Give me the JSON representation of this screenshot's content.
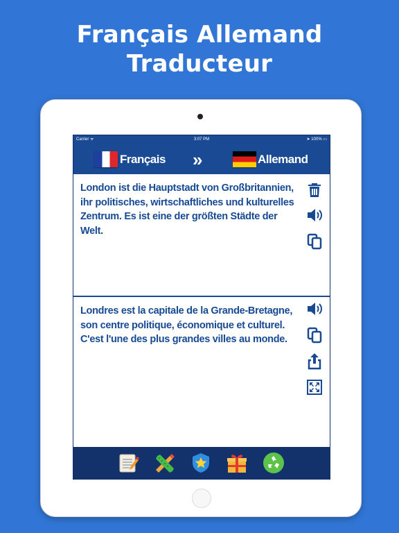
{
  "headline": {
    "line1": "Français Allemand",
    "line2": "Traducteur"
  },
  "status_bar": {
    "carrier": "Carrier ᯤ",
    "time": "3:07 PM",
    "battery": "➤ 100% ▭"
  },
  "language_bar": {
    "source_language": "Français",
    "target_language": "Allemand",
    "swap_glyph": "»"
  },
  "source_pane": {
    "text": "London ist die Hauptstadt von Großbritannien, ihr politisches, wirtschaftliches und kulturelles Zentrum. Es ist eine der größten Städte der Welt.",
    "actions": [
      "trash-icon",
      "speaker-icon",
      "copy-icon"
    ]
  },
  "result_pane": {
    "text": "Londres est la capitale de la Grande-Bretagne, son centre politique, économique et culturel. C'est l'une des plus grandes villes au monde.",
    "actions": [
      "speaker-icon",
      "copy-icon",
      "share-icon",
      "expand-icon"
    ]
  },
  "tab_bar": {
    "items": [
      "notepad-icon",
      "tools-icon",
      "star-badge-icon",
      "gift-icon",
      "recycle-icon"
    ]
  },
  "colors": {
    "background": "#3176d6",
    "app_bar": "#1a4a93",
    "tab_bar": "#13316a",
    "text": "#174a93"
  }
}
